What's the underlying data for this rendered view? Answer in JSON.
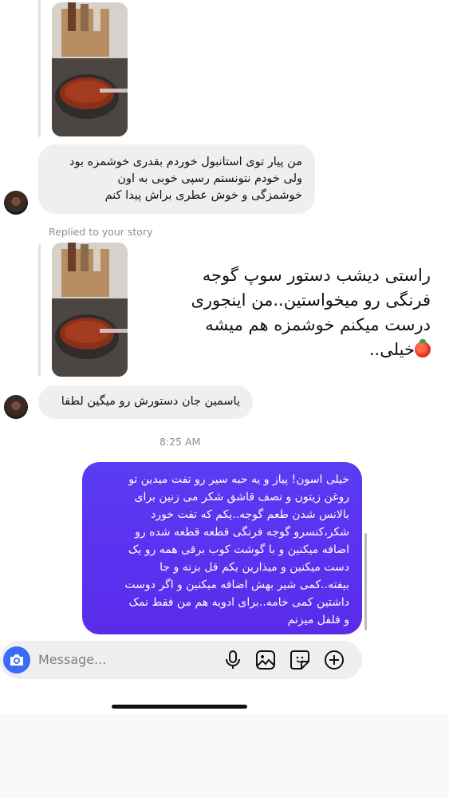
{
  "messages": {
    "incoming_1": [
      "من پیار توی استانبول خوردم بقدری خوشمزه بود",
      "ولی خودم نتونستم رسپی خوبی به اون",
      "خوشمزگی و خوش عطری براش پیدا کنم"
    ],
    "replied_label": "Replied to your story",
    "story_caption": [
      "راستی دیشب دستور سوپ گوجه",
      "فرنگی رو میخواستین..من اینجوری",
      "درست میکنم خوشمزه هم میشه",
      "خیلی.."
    ],
    "incoming_2": "یاسمین جان دستورش رو میگین لطفا",
    "timestamp": "8:25 AM",
    "outgoing": [
      "خیلی اسون! پیاز و یه حبه سیر رو تفت میدین تو",
      "روغن زیتون و نصف قاشق شکر می زنین برای",
      "بالانس شدن طعم گوجه..یکم که تفت خورد",
      "شکر،کنسرو گوجه فرنگی قطعه قطعه شده رو",
      "اضافه میکنین  و با گوشت کوب برقی همه رو یک",
      "دست میکنین و میذارین یکم قل بزنه و جا",
      "بیفته..کمی شیر بهش اضافه میکنین و اگر دوست",
      "داشتین کمی خامه..برای ادویه هم من فقط نمک",
      "و فلفل میزنم"
    ]
  },
  "composer": {
    "placeholder": "Message...",
    "icons": [
      "camera-icon",
      "microphone-icon",
      "gallery-icon",
      "sticker-icon",
      "add-icon"
    ]
  },
  "colors": {
    "outgoing_bubble": "#5b32f0",
    "incoming_bubble": "#efeff2",
    "camera_button": "#3b6cf6"
  }
}
